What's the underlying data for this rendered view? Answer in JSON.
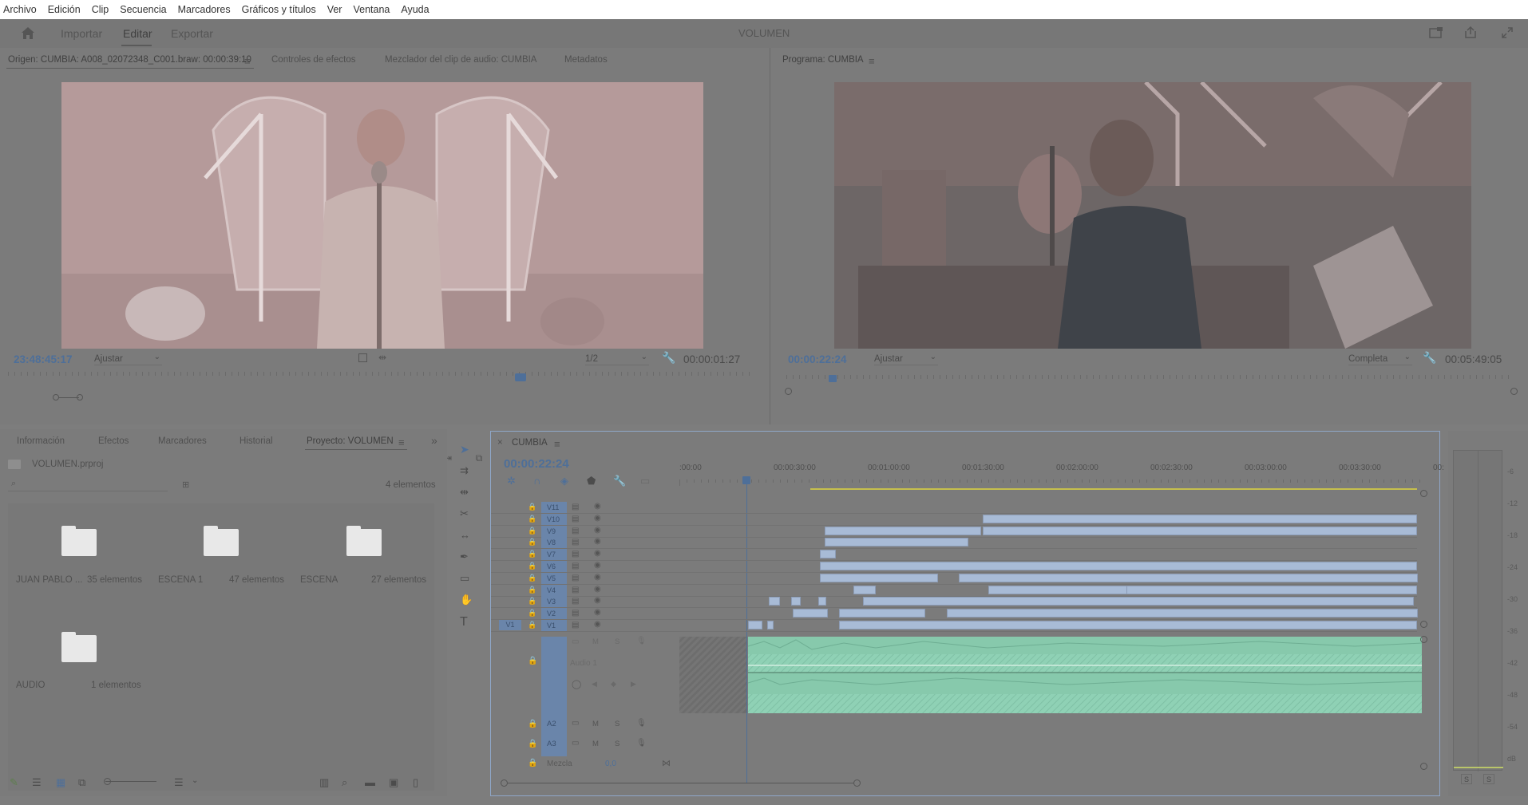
{
  "menu": [
    "Archivo",
    "Edición",
    "Clip",
    "Secuencia",
    "Marcadores",
    "Gráficos y títulos",
    "Ver",
    "Ventana",
    "Ayuda"
  ],
  "workspace": {
    "tabs": [
      "Importar",
      "Editar",
      "Exportar"
    ],
    "title": "VOLUMEN"
  },
  "source": {
    "tabs": [
      "Origen: CUMBIA: A008_02072348_C001.braw: 00:00:39:10",
      "Controles de efectos",
      "Mezclador del clip de audio: CUMBIA",
      "Metadatos"
    ],
    "timecode_in": "23:48:45:17",
    "fit": "Ajustar",
    "resolution": "1/2",
    "duration": "00:00:01:27"
  },
  "program": {
    "tab": "Programa: CUMBIA",
    "timecode": "00:00:22:24",
    "fit": "Ajustar",
    "quality": "Completa",
    "duration": "00:05:49:05"
  },
  "project": {
    "tabs": [
      "Información",
      "Efectos",
      "Marcadores",
      "Historial",
      "Proyecto: VOLUMEN"
    ],
    "file": "VOLUMEN.prproj",
    "count": "4 elementos",
    "bins": [
      {
        "name": "JUAN PABLO ...",
        "count": "35 elementos"
      },
      {
        "name": "ESCENA 1",
        "count": "47 elementos"
      },
      {
        "name": "ESCENA",
        "count": "27 elementos"
      },
      {
        "name": "AUDIO",
        "count": "1 elementos"
      }
    ]
  },
  "timeline": {
    "sequence": "CUMBIA",
    "timecode": "00:00:22:24",
    "ruler": [
      ":00:00",
      "00:00:30:00",
      "00:01:00:00",
      "00:01:30:00",
      "00:02:00:00",
      "00:02:30:00",
      "00:03:00:00",
      "00:03:30:00",
      "00:"
    ],
    "video_tracks": [
      "V11",
      "V10",
      "V9",
      "V8",
      "V7",
      "V6",
      "V5",
      "V4",
      "V3",
      "V2",
      "V1"
    ],
    "source_patch_v": "V1",
    "audio_a1_name": "Audio 1",
    "audio_tracks": [
      "A2",
      "A3"
    ],
    "mix_label": "Mezcla",
    "mix_value": "0,0",
    "track_buttons": {
      "mute": "M",
      "solo": "S"
    }
  },
  "meter": {
    "labels": [
      "-6",
      "-12",
      "-18",
      "-24",
      "-30",
      "-36",
      "-42",
      "-48",
      "-54",
      "dB"
    ],
    "solo": [
      "S",
      "S"
    ]
  }
}
